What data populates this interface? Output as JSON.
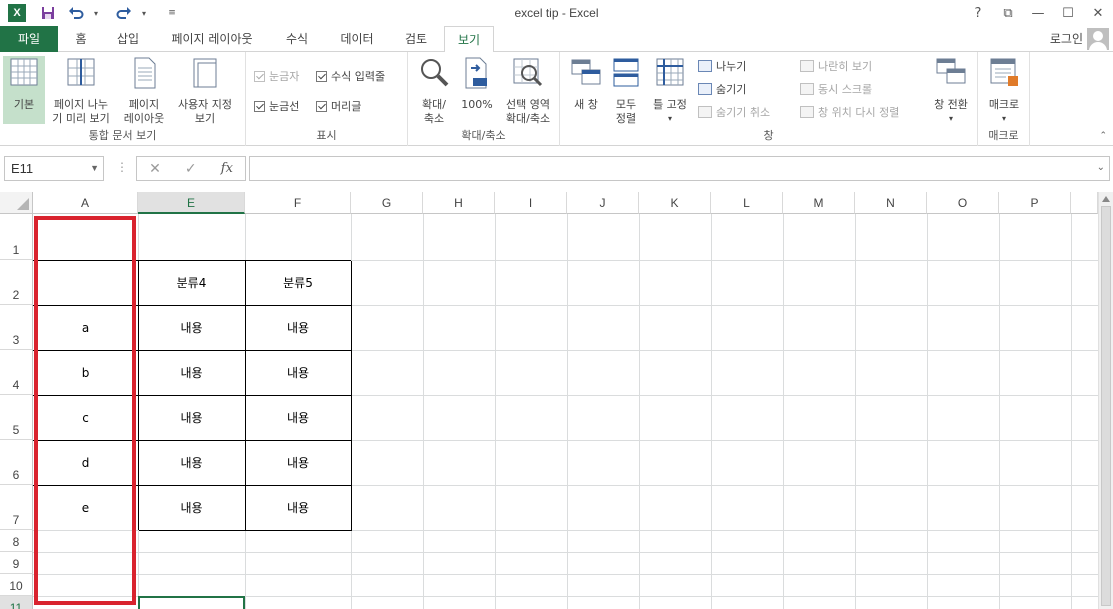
{
  "window": {
    "title": "excel tip - Excel",
    "controls": [
      "?",
      "⧉",
      "—",
      "☐",
      "✕"
    ]
  },
  "qat": {
    "logo": "X"
  },
  "tabs": [
    "파일",
    "홈",
    "삽입",
    "페이지 레이아웃",
    "수식",
    "데이터",
    "검토",
    "보기"
  ],
  "active_tab": "보기",
  "account": {
    "login_label": "로그인"
  },
  "ribbon": {
    "workbook_views": {
      "label": "통합 문서 보기",
      "normal": "기본",
      "page_break_1": "페이지 나누",
      "page_break_2": "기 미리 보기",
      "page_layout_1": "페이지",
      "page_layout_2": "레이아웃",
      "custom_1": "사용자 지정",
      "custom_2": "보기"
    },
    "show": {
      "label": "표시",
      "ruler": "눈금자",
      "formula_bar": "수식 입력줄",
      "gridlines": "눈금선",
      "headings": "머리글"
    },
    "zoom": {
      "label": "확대/축소",
      "zoom_1": "확대/",
      "zoom_2": "축소",
      "hundred": "100%",
      "selection_1": "선택 영역",
      "selection_2": "확대/축소"
    },
    "window": {
      "label": "창",
      "new_window": "새 창",
      "arrange_1": "모두",
      "arrange_2": "정렬",
      "freeze": "틀 고정",
      "split": "나누기",
      "hide": "숨기기",
      "unhide": "숨기기 취소",
      "side_by_side": "나란히 보기",
      "sync_scroll": "동시 스크롤",
      "reset_position": "창 위치 다시 정렬",
      "switch": "창 전환"
    },
    "macros": {
      "label": "매크로",
      "macro": "매크로"
    }
  },
  "formula_bar": {
    "name_box": "E11",
    "cancel": "✕",
    "enter": "✓",
    "fx": "fx",
    "value": ""
  },
  "columns": [
    "A",
    "E",
    "F",
    "G",
    "H",
    "I",
    "J",
    "K",
    "L",
    "M",
    "N",
    "O",
    "P"
  ],
  "selected_column": "E",
  "rows": [
    "1",
    "2",
    "3",
    "4",
    "5",
    "6",
    "7",
    "8",
    "9",
    "10",
    "11"
  ],
  "selected_row": "11",
  "sheet": {
    "table_headers": [
      "분류4",
      "분류5"
    ],
    "rows": [
      {
        "a": "a",
        "e": "내용",
        "f": "내용"
      },
      {
        "a": "b",
        "e": "내용",
        "f": "내용"
      },
      {
        "a": "c",
        "e": "내용",
        "f": "내용"
      },
      {
        "a": "d",
        "e": "내용",
        "f": "내용"
      },
      {
        "a": "e",
        "e": "내용",
        "f": "내용"
      }
    ]
  },
  "colors": {
    "excel_green": "#217346",
    "highlight_red": "#d9232e",
    "selected_button": "#c5e0cb"
  }
}
